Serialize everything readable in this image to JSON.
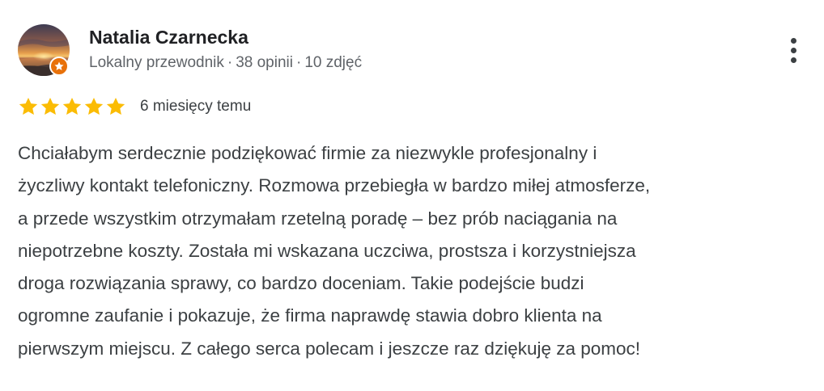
{
  "reviewer": {
    "name": "Natalia Czarnecka",
    "role": "Lokalny przewodnik",
    "reviews_count": "38 opinii",
    "photos_count": "10 zdjęć",
    "separator": "·",
    "avatar_icon": "sunset-beach-photo",
    "badge_icon": "local-guide-star-icon",
    "badge_color": "#e8710a"
  },
  "menu": {
    "icon": "more-vertical-icon"
  },
  "rating": {
    "stars": 5,
    "max_stars": 5,
    "star_color": "#fbbc04",
    "date": "6 miesięcy temu"
  },
  "review": {
    "lines": [
      "Chciałabym serdecznie podziękować firmie za niezwykle profesjonalny i",
      "życzliwy kontakt telefoniczny. Rozmowa przebiegła w bardzo miłej atmosferze,",
      "a przede wszystkim otrzymałam rzetelną poradę – bez prób naciągania na",
      "niepotrzebne koszty. Została mi wskazana uczciwa, prostsza i korzystniejsza",
      "droga rozwiązania sprawy, co bardzo doceniam. Takie podejście budzi",
      "ogromne zaufanie i pokazuje, że firma naprawdę stawia dobro klienta na",
      "pierwszym miejscu. Z całego serca polecam i jeszcze raz dziękuję za pomoc!"
    ]
  }
}
